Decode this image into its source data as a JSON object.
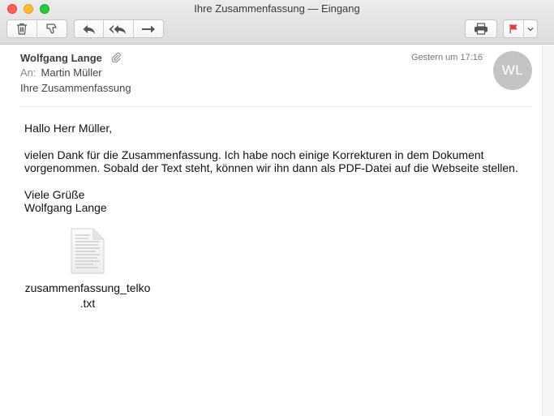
{
  "window": {
    "title": "Ihre Zusammenfassung — Eingang"
  },
  "toolbar": {
    "buttons": [
      {
        "icon": "trash-icon"
      },
      {
        "icon": "junk-icon"
      },
      {
        "icon": "reply-icon"
      },
      {
        "icon": "reply-all-icon"
      },
      {
        "icon": "forward-icon"
      },
      {
        "icon": "print-icon"
      },
      {
        "icon": "flag-icon"
      },
      {
        "icon": "chevron-down-icon"
      }
    ],
    "flag_color": "#f33a3a"
  },
  "message": {
    "sender": "Wolfgang Lange",
    "date": "Gestern um 17:16",
    "to_label": "An:",
    "to": "Martin Müller",
    "subject": "Ihre Zusammenfassung",
    "avatar_initials": "WL",
    "body": {
      "greeting": "Hallo Herr Müller,",
      "line1": "vielen Dank für die Zusammenfassung. Ich habe noch einige Korrekturen in dem Dokument",
      "line2": "vorgenommen. Sobald der Text steht, können wir ihn dann als PDF-Datei auf die Webseite stellen.",
      "closing": "Viele Grüße",
      "signature": "Wolfgang Lange"
    },
    "attachment": {
      "name_line1": "zusammenfassung_telko",
      "name_line2": ".txt"
    }
  }
}
